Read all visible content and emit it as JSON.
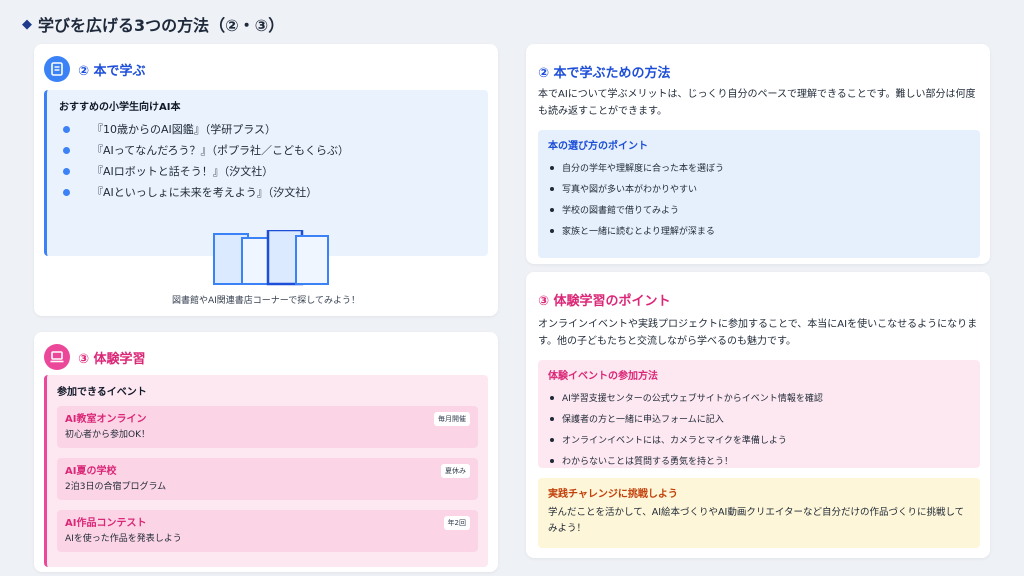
{
  "page_title": "学びを広げる3つの方法（②・③）",
  "books_card": {
    "title": "② 本で学ぶ",
    "rec_title": "おすすめの小学生向けAI本",
    "books": [
      "『10歳からのAI図鑑』（学研プラス）",
      "『AIってなんだろう？』（ポプラ社／こどもくらぶ）",
      "『AIロボットと話そう！』（汐文社）",
      "『AIといっしょに未来を考えよう』（汐文社）"
    ],
    "caption": "図書館やAI関連書店コーナーで探してみよう！"
  },
  "exp_card": {
    "title": "③ 体験学習",
    "events_title": "参加できるイベント",
    "events": [
      {
        "name": "AI教室オンライン",
        "desc": "初心者から参加OK！",
        "tag": "毎月開催"
      },
      {
        "name": "AI夏の学校",
        "desc": "2泊3日の合宿プログラム",
        "tag": "夏休み"
      },
      {
        "name": "AI作品コンテスト",
        "desc": "AIを使った作品を発表しよう",
        "tag": "年2回"
      }
    ]
  },
  "how_card": {
    "title": "② 本で学ぶための方法",
    "intro": "本でAIについて学ぶメリットは、じっくり自分のペースで理解できることです。難しい部分は何度も読み返すことができます。",
    "points_title": "本の選び方のポイント",
    "points": [
      "自分の学年や理解度に合った本を選ぼう",
      "写真や図が多い本がわかりやすい",
      "学校の図書館で借りてみよう",
      "家族と一緒に読むとより理解が深まる"
    ]
  },
  "point_card": {
    "title": "③ 体験学習のポイント",
    "intro": "オンラインイベントや実践プロジェクトに参加することで、本当にAIを使いこなせるようになります。他の子どもたちと交流しながら学べるのも魅力です。",
    "method_title": "体験イベントの参加方法",
    "methods": [
      "AI学習支援センターの公式ウェブサイトからイベント情報を確認",
      "保護者の方と一緒に申込フォームに記入",
      "オンラインイベントには、カメラとマイクを準備しよう",
      "わからないことは質問する勇気を持とう！"
    ],
    "challenge_title": "実践チャレンジに挑戦しよう",
    "challenge_text": "学んだことを活かして、AI絵本づくりやAI動画クリエイターなど自分だけの作品づくりに挑戦してみよう！"
  },
  "colors": {
    "blue": "#3b82f6",
    "pink": "#ec4899",
    "orange": "#c2410c"
  },
  "icons": {
    "books": "book-icon",
    "exp": "laptop-icon",
    "title": "diamond-icon"
  }
}
